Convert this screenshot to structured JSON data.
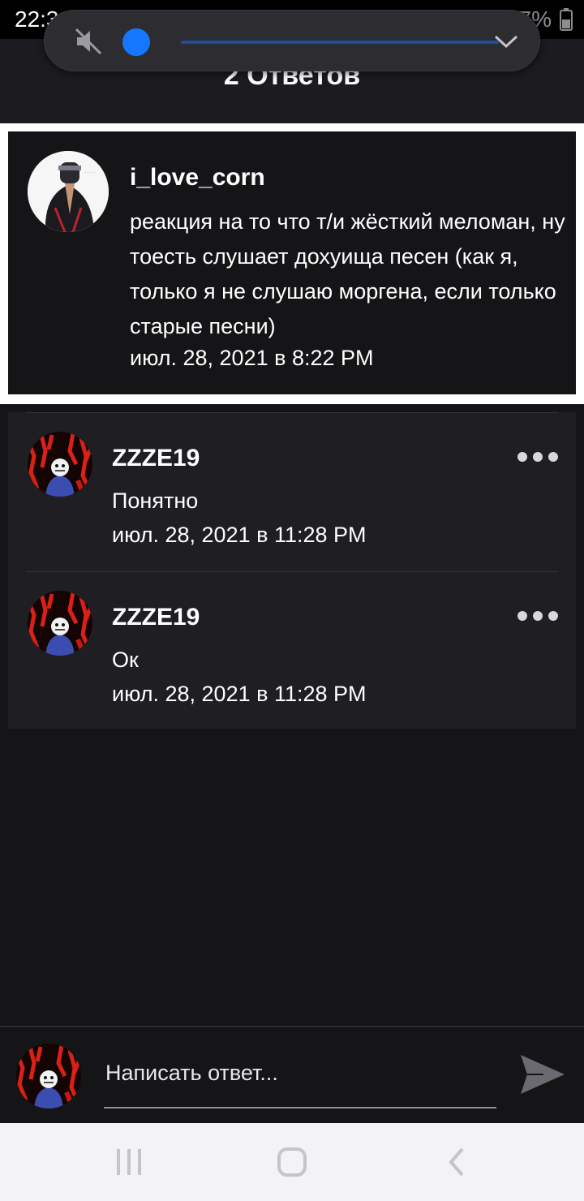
{
  "status_bar": {
    "time": "22:34",
    "battery": "47%"
  },
  "header": {
    "title": "2 Ответов"
  },
  "volume": {
    "level": 0.0
  },
  "parent_comment": {
    "author": "i_love_corn",
    "text": "реакция на то что т/и жёсткий меломан, ну тоесть слушает дохуища песен (как я, только я не слушаю моргена, если только старые песни)",
    "date": "июл. 28, 2021 в 8:22 PM"
  },
  "replies": [
    {
      "author": "ZZZE19",
      "text": "Понятно",
      "date": "июл. 28, 2021 в 11:28 PM"
    },
    {
      "author": "ZZZE19",
      "text": "Ок",
      "date": "июл. 28, 2021 в 11:28 PM"
    }
  ],
  "compose": {
    "placeholder": "Написать ответ..."
  },
  "icons": {
    "mute": "mute-icon",
    "more": "more-icon",
    "send": "send-icon",
    "recent_apps": "recent-apps-icon",
    "home": "home-icon",
    "back": "back-icon"
  },
  "colors": {
    "background": "#151417",
    "card": "#1f1e22",
    "accent": "#1577ff"
  }
}
